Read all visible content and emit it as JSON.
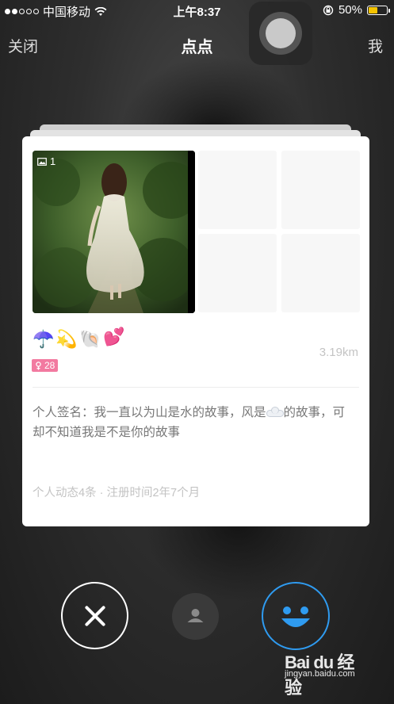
{
  "status_bar": {
    "carrier": "中国移动",
    "time": "上午8:37",
    "battery": "50%",
    "battery_level": 0.5,
    "signal_dots_filled": 2,
    "signal_dots_total": 5
  },
  "nav": {
    "close": "关闭",
    "title": "点点",
    "me": "我"
  },
  "card": {
    "photo_count": "1",
    "emojis": [
      "☂️",
      "💫",
      "🐚",
      "💕"
    ],
    "age_badge": "28",
    "distance": "3.19km",
    "signature_text1": "个人签名：我一直以为山是水的故事，风是",
    "signature_text2": "的故事，可却不知道我是不是你的故事",
    "meta": "个人动态4条 · 注册时间2年7个月"
  },
  "watermark": {
    "logo": "Bai du 经验",
    "url": "jingyan.baidu.com"
  },
  "colors": {
    "like_accent": "#2f9bf0",
    "badge_pink": "#f27aa0",
    "battery_yellow": "#f5c400"
  }
}
